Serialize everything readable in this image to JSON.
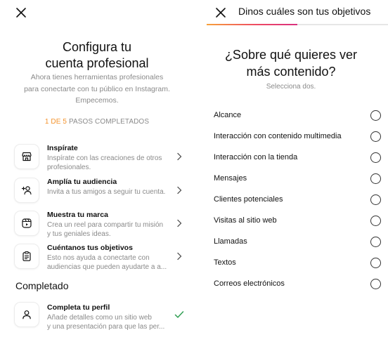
{
  "left": {
    "title_line1": "Configura tu",
    "title_line2": "cuenta profesional",
    "desc_line1": "Ahora tienes herramientas profesionales",
    "desc_line2": "para conectarte con tu público en Instagram.",
    "desc_line3": "Empecemos.",
    "progress": {
      "count": "1 DE 5",
      "suffix": "PASOS COMPLETADOS"
    },
    "steps": [
      {
        "icon": "store-icon",
        "title": "Inspírate",
        "line1": "Inspírate con las creaciones de otros",
        "line2": "profesionales."
      },
      {
        "icon": "add-person-icon",
        "title": "Amplía tu audiencia",
        "line1": "Invita a tus amigos a seguir tu cuenta.",
        "line2": ""
      },
      {
        "icon": "reel-icon",
        "title": "Muestra tu marca",
        "line1": "Crea un reel para compartir tu misión",
        "line2": "y tus geniales ideas."
      },
      {
        "icon": "clipboard-icon",
        "title": "Cuéntanos tus objetivos",
        "line1": "Esto nos ayuda a conectarte con",
        "line2": "audiencias que pueden ayudarte a a..."
      }
    ],
    "completed_heading": "Completado",
    "completed_step": {
      "icon": "person-icon",
      "title": "Completa tu perfil",
      "line1": "Añade detalles como un sitio web",
      "line2": "y una presentación para que las per..."
    }
  },
  "right": {
    "header": "Dinos cuáles son tus objetivos",
    "progress_fraction": 0.5,
    "question_line1": "¿Sobre qué quieres ver",
    "question_line2": "más contenido?",
    "subtitle": "Selecciona dos.",
    "options": [
      "Alcance",
      "Interacción con contenido multimedia",
      "Interacción con la tienda",
      "Mensajes",
      "Clientes potenciales",
      "Visitas al sitio web",
      "Llamadas",
      "Textos",
      "Correos electrónicos"
    ]
  },
  "colors": {
    "accent_orange": "#f4922b",
    "check_green": "#2f9e52",
    "muted_text": "#8a8a8a"
  }
}
